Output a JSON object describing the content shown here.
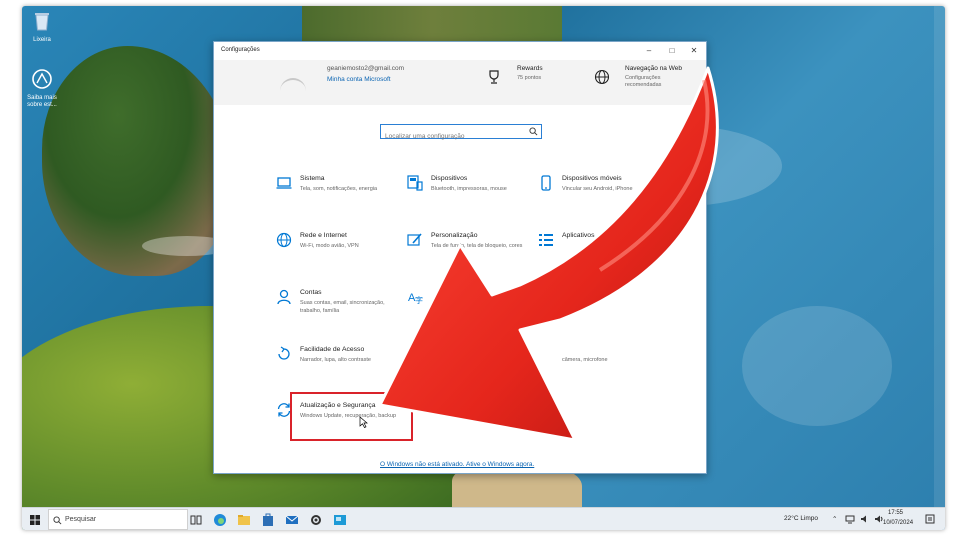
{
  "desktop": {
    "icons": [
      {
        "label": "Lixeira"
      },
      {
        "label": "Saiba mais sobre est..."
      }
    ]
  },
  "window": {
    "title": "Configurações",
    "account": {
      "email": "geaniemosto2@gmail.com",
      "link": "Minha conta Microsoft"
    },
    "header_items": [
      {
        "title": "Rewards",
        "subtitle": "75 pontos",
        "icon": "trophy-icon"
      },
      {
        "title": "Navegação na Web",
        "subtitle": "Configurações recomendadas",
        "icon": "globe-icon"
      }
    ],
    "search": {
      "placeholder": "Localizar uma configuração"
    },
    "categories": [
      {
        "title": "Sistema",
        "desc": "Tela, som, notificações, energia",
        "icon": "laptop-icon"
      },
      {
        "title": "Dispositivos",
        "desc": "Bluetooth, impressoras, mouse",
        "icon": "devices-icon"
      },
      {
        "title": "Dispositivos móveis",
        "desc": "Vincular seu Android, iPhone",
        "icon": "phone-icon"
      },
      {
        "title": "Rede e Internet",
        "desc": "Wi-Fi, modo avião, VPN",
        "icon": "globe-icon"
      },
      {
        "title": "Personalização",
        "desc": "Tela de fundo, tela de bloqueio, cores",
        "icon": "personalize-icon"
      },
      {
        "title": "Aplicativos",
        "desc": "",
        "icon": "apps-icon"
      },
      {
        "title": "Contas",
        "desc": "Suas contas, email, sincronização, trabalho, família",
        "icon": "person-icon"
      },
      {
        "title": "",
        "desc": "",
        "icon": "language-icon"
      },
      {
        "title": "Facilidade de Acesso",
        "desc": "Narrador, lupa, alto contraste",
        "icon": "accessibility-icon"
      },
      {
        "title": "",
        "desc": "câmera, microfone",
        "icon": "privacy-icon"
      },
      {
        "title": "Atualização e Segurança",
        "desc": "Windows Update, recuperação, backup",
        "icon": "update-icon"
      }
    ],
    "activation_link": "O Windows não está ativado. Ative o Windows agora."
  },
  "taskbar": {
    "search_placeholder": "Pesquisar",
    "weather": "22°C  Limpo",
    "time": "17:55",
    "date": "10/07/2024"
  },
  "colors": {
    "accent": "#0078d4",
    "link": "#0a64b2",
    "highlight": "#d9232a",
    "arrow": "#e5261c"
  }
}
